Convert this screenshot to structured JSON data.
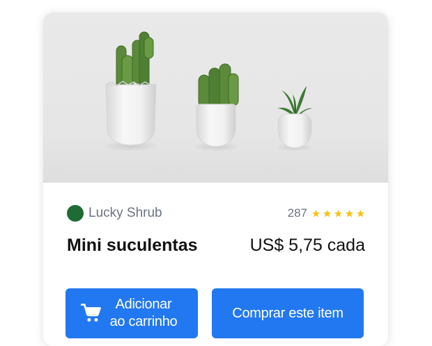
{
  "product": {
    "brand": "Lucky Shrub",
    "rating_count": "287",
    "stars": 5,
    "title": "Mini suculentas",
    "price": "US$ 5,75 cada"
  },
  "actions": {
    "add_to_cart_line1": "Adicionar",
    "add_to_cart_line2": "ao carrinho",
    "buy": "Comprar este item"
  },
  "colors": {
    "brand_dot": "#1e6b33",
    "button": "#2278f0",
    "star": "#f5c518"
  },
  "icons": {
    "cart": "shopping-cart-icon",
    "star": "star-icon"
  }
}
